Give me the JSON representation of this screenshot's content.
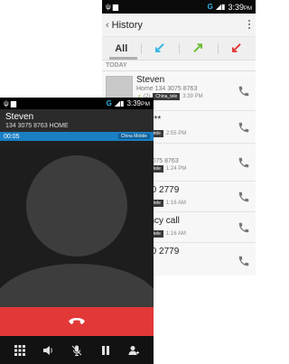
{
  "history": {
    "status": {
      "signal": "G",
      "time": "3:39",
      "ampm": "PM"
    },
    "back": "‹",
    "title": "History",
    "tabs": {
      "all": "All",
      "incoming": "↙",
      "outgoing": "↗",
      "missed": "↙"
    },
    "colors": {
      "incoming": "#33b5e5",
      "outgoing": "#6dbf3a",
      "missed": "#e53935"
    },
    "section": "TODAY",
    "entries": [
      {
        "name": "Steven",
        "sub": "Home 134 3075 8763",
        "count": "(2)",
        "tag": "China_tele",
        "time": "3:39 PM"
      },
      {
        "name": "*******",
        "sub": "",
        "count": "",
        "tag": "China_tele",
        "time": "2:55 PM"
      },
      {
        "name": "en",
        "sub": "134 3075 8763",
        "count": "",
        "tag": "China_tele",
        "time": "1:24 PM"
      },
      {
        "name": "8910 2779",
        "sub": "",
        "count": "",
        "tag": "China_tele",
        "time": "1:16 AM"
      },
      {
        "name": "rgency call",
        "sub": "",
        "count": "",
        "tag": "China_tele",
        "time": "1:16 AM"
      },
      {
        "name": "8910 2779",
        "sub": "",
        "count": "",
        "tag": "",
        "time": ""
      }
    ]
  },
  "call": {
    "status": {
      "signal": "G",
      "time": "3:39",
      "ampm": "PM"
    },
    "caller_name": "Steven",
    "caller_number": "134 3075 8763 HOME",
    "elapsed": "00:05",
    "operator": "China Mobile",
    "end_call_color": "#e23838",
    "tools": [
      "dialpad-icon",
      "speaker-icon",
      "mute-icon",
      "hold-icon",
      "add-call-icon"
    ]
  }
}
